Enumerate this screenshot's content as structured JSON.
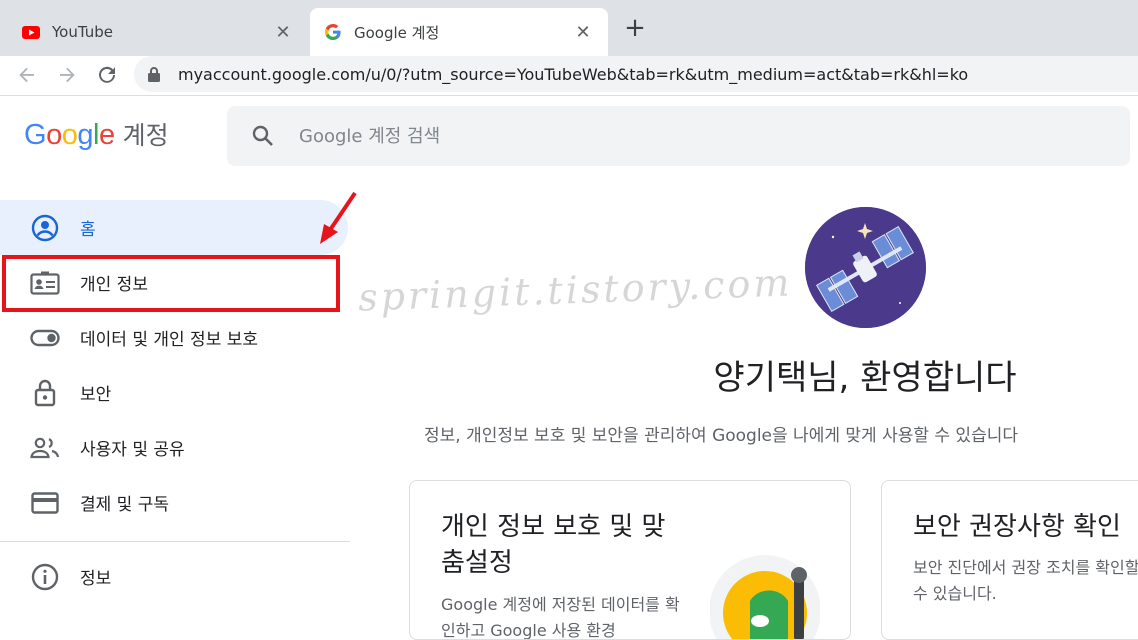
{
  "browser": {
    "tabs": [
      {
        "title": "YouTube",
        "active": false
      },
      {
        "title": "Google 계정",
        "active": true
      }
    ],
    "url": "myaccount.google.com/u/0/?utm_source=YouTubeWeb&tab=rk&utm_medium=act&tab=rk&hl=ko"
  },
  "header": {
    "logo_word": "Google",
    "logo_suffix": "계정",
    "search_placeholder": "Google 계정 검색"
  },
  "sidebar": {
    "items": [
      {
        "label": "홈",
        "icon": "account-circle-icon",
        "active": true
      },
      {
        "label": "개인 정보",
        "icon": "id-card-icon",
        "active": false
      },
      {
        "label": "데이터 및 개인 정보 보호",
        "icon": "toggle-icon",
        "active": false
      },
      {
        "label": "보안",
        "icon": "lock-icon",
        "active": false
      },
      {
        "label": "사용자 및 공유",
        "icon": "people-icon",
        "active": false
      },
      {
        "label": "결제 및 구독",
        "icon": "credit-card-icon",
        "active": false
      },
      {
        "label": "정보",
        "icon": "info-icon",
        "active": false
      }
    ]
  },
  "watermark": "springit.tistory.com",
  "main": {
    "welcome": "양기택님, 환영합니다",
    "subtitle": "정보, 개인정보 보호 및 보안을 관리하여 Google을 나에게 맞게 사용할 수 있습니다",
    "cards": [
      {
        "title": "개인 정보 보호 및 맞춤설정",
        "body": "Google 계정에 저장된 데이터를 확인하고 Google 사용 환경"
      },
      {
        "title": "보안 권장사항 확인",
        "body": "보안 진단에서 권장 조치를 확인할 수 있습니다."
      }
    ]
  },
  "colors": {
    "accent": "#1a73e8",
    "active_bg": "#e8f0fe",
    "highlight": "#e8141b"
  }
}
